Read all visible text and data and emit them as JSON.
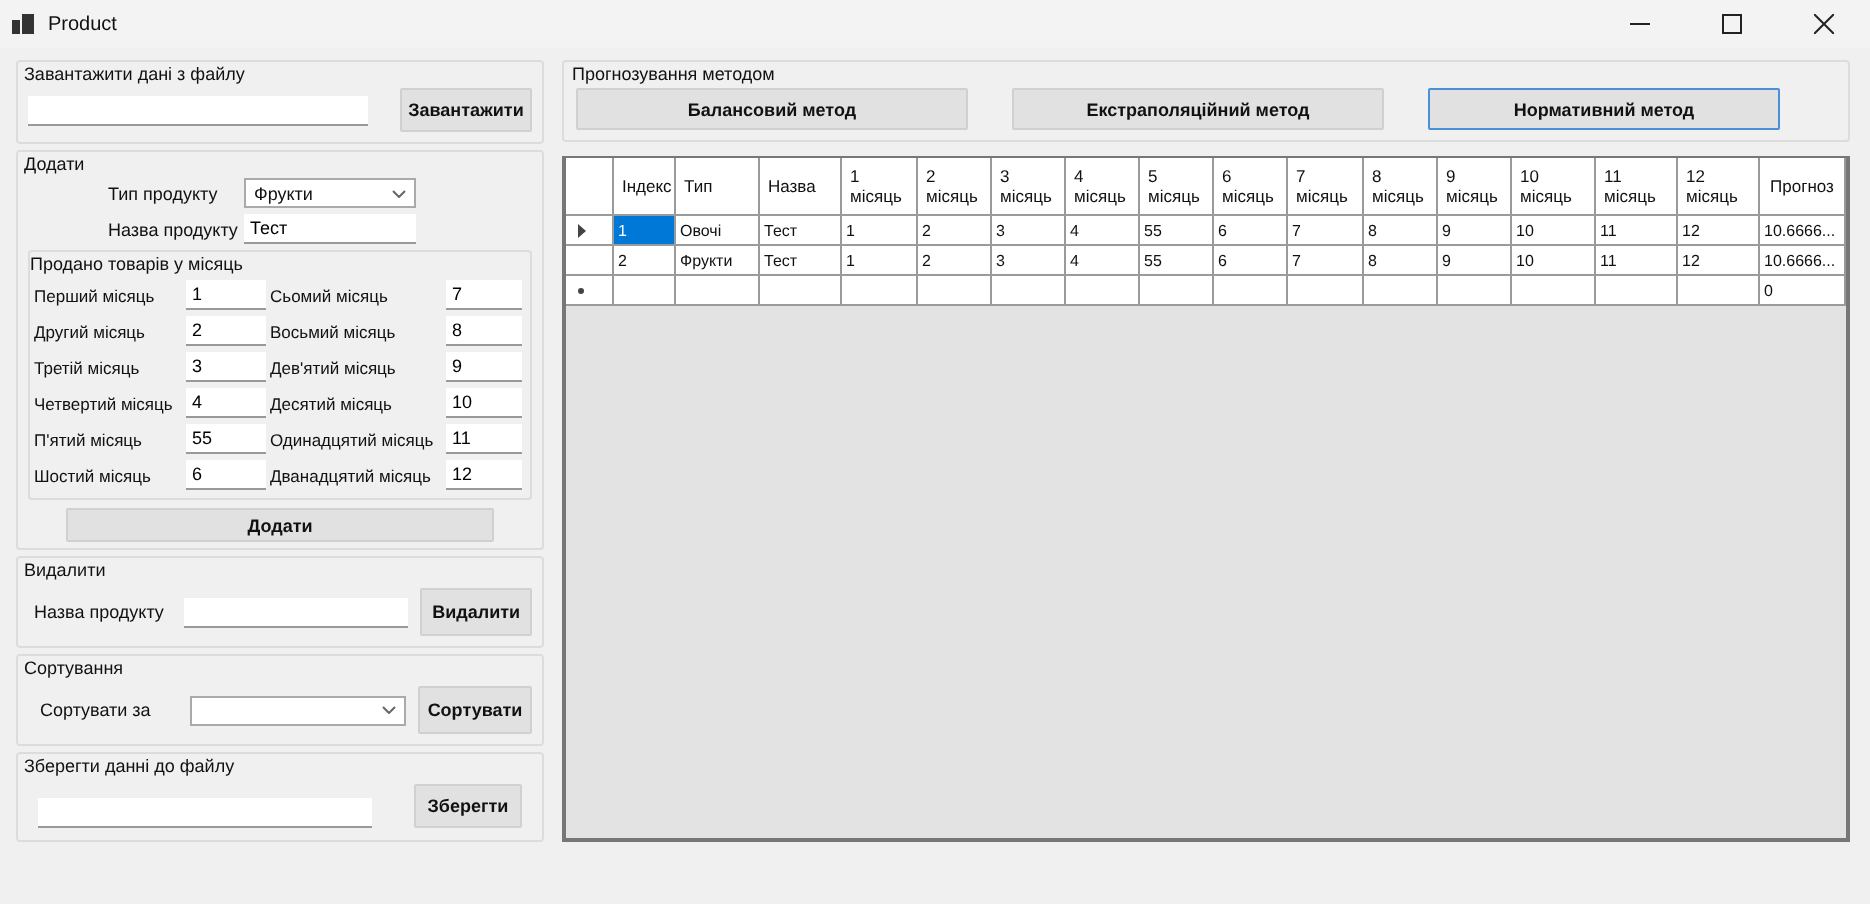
{
  "window": {
    "title": "Product"
  },
  "load_group": {
    "title": "Завантажити дані з файлу",
    "button": "Завантажити"
  },
  "add_group": {
    "title": "Додати",
    "type_label": "Тип продукту",
    "type_value": "Фрукти",
    "name_label": "Назва продукту",
    "name_value": "Тест",
    "sold_title": "Продано товарів у місяць",
    "months": [
      {
        "label": "Перший місяць",
        "value": "1"
      },
      {
        "label": "Сьомий місяць",
        "value": "7"
      },
      {
        "label": "Другий місяць",
        "value": "2"
      },
      {
        "label": "Восьмий місяць",
        "value": "8"
      },
      {
        "label": "Третій місяць",
        "value": "3"
      },
      {
        "label": "Дев'ятий місяць",
        "value": "9"
      },
      {
        "label": "Четвертий місяць",
        "value": "4"
      },
      {
        "label": "Десятий місяць",
        "value": "10"
      },
      {
        "label": "П'ятий місяць",
        "value": "55"
      },
      {
        "label": "Одинадцятий місяць",
        "value": "11"
      },
      {
        "label": "Шостий місяць",
        "value": "6"
      },
      {
        "label": "Дванадцятий місяць",
        "value": "12"
      }
    ],
    "button": "Додати"
  },
  "delete_group": {
    "title": "Видалити",
    "name_label": "Назва продукту",
    "button": "Видалити"
  },
  "sort_group": {
    "title": "Сортування",
    "label": "Сортувати за",
    "button": "Сортувати"
  },
  "save_group": {
    "title": "Зберегти данні до файлу",
    "button": "Зберегти"
  },
  "forecast": {
    "title": "Прогнозування методом",
    "methods": [
      {
        "label": "Балансовий метод",
        "selected": false
      },
      {
        "label": "Екстраполяційний метод",
        "selected": false
      },
      {
        "label": "Нормативний метод",
        "selected": true
      }
    ]
  },
  "table": {
    "columns": [
      "Індекс",
      "Тип",
      "Назва",
      "1 місяць",
      "2 місяць",
      "3 місяць",
      "4 місяць",
      "5 місяць",
      "6 місяць",
      "7 місяць",
      "8 місяць",
      "9 місяць",
      "10 місяць",
      "11 місяць",
      "12 місяць",
      "Прогноз"
    ],
    "rows": [
      {
        "kind": "current",
        "cells": [
          {
            "text": "1",
            "selected": true
          },
          {
            "text": "Овочі",
            "selected": false
          },
          {
            "text": "Тест",
            "selected": false
          },
          {
            "text": "1",
            "selected": false
          },
          {
            "text": "2",
            "selected": false
          },
          {
            "text": "3",
            "selected": false
          },
          {
            "text": "4",
            "selected": false
          },
          {
            "text": "55",
            "selected": false
          },
          {
            "text": "6",
            "selected": false
          },
          {
            "text": "7",
            "selected": false
          },
          {
            "text": "8",
            "selected": false
          },
          {
            "text": "9",
            "selected": false
          },
          {
            "text": "10",
            "selected": false
          },
          {
            "text": "11",
            "selected": false
          },
          {
            "text": "12",
            "selected": false
          },
          {
            "text": "10.6666...",
            "selected": false
          }
        ]
      },
      {
        "kind": "normal",
        "cells": [
          {
            "text": "2",
            "selected": false
          },
          {
            "text": "Фрукти",
            "selected": false
          },
          {
            "text": "Тест",
            "selected": false
          },
          {
            "text": "1",
            "selected": false
          },
          {
            "text": "2",
            "selected": false
          },
          {
            "text": "3",
            "selected": false
          },
          {
            "text": "4",
            "selected": false
          },
          {
            "text": "55",
            "selected": false
          },
          {
            "text": "6",
            "selected": false
          },
          {
            "text": "7",
            "selected": false
          },
          {
            "text": "8",
            "selected": false
          },
          {
            "text": "9",
            "selected": false
          },
          {
            "text": "10",
            "selected": false
          },
          {
            "text": "11",
            "selected": false
          },
          {
            "text": "12",
            "selected": false
          },
          {
            "text": "10.6666...",
            "selected": false
          }
        ]
      },
      {
        "kind": "new",
        "forecast": "0"
      }
    ]
  }
}
